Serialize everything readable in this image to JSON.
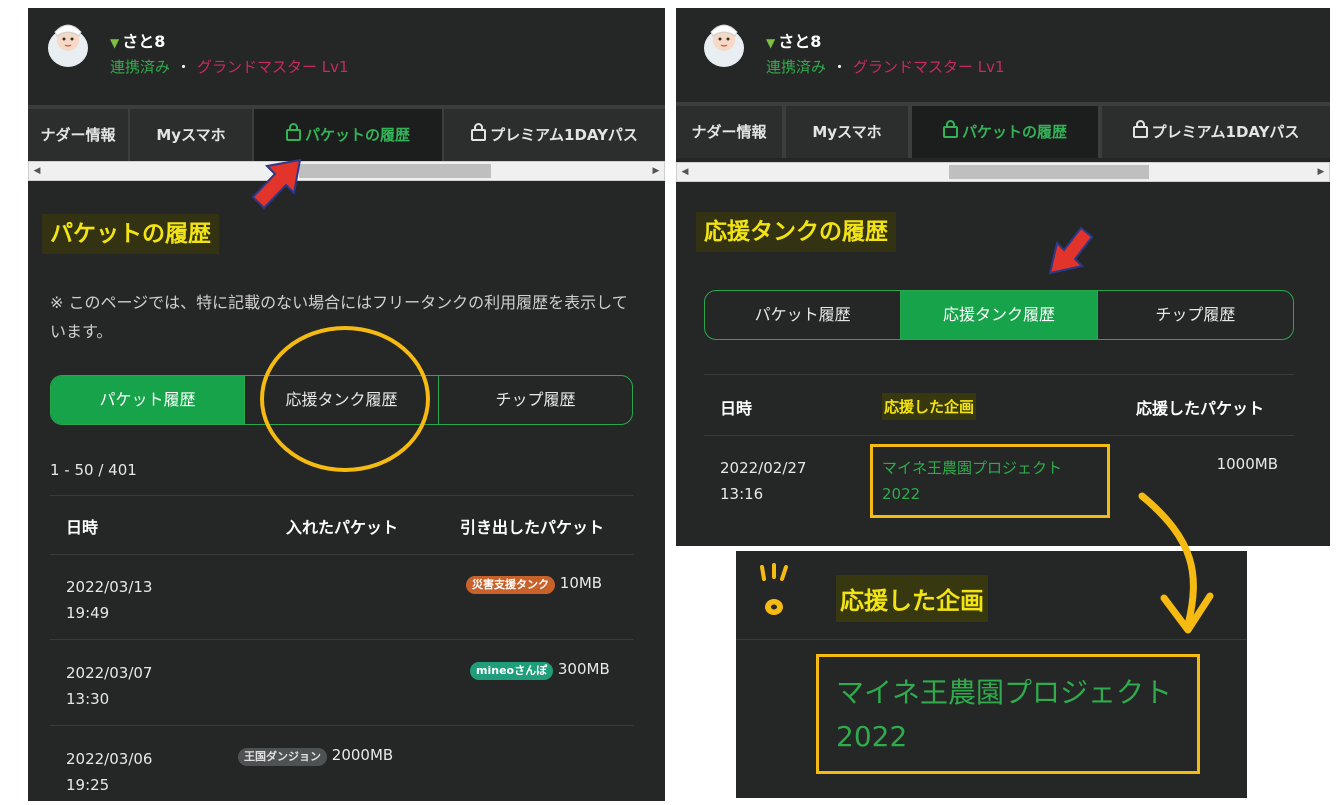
{
  "user": {
    "name": "さと8",
    "status_linked": "連携済み",
    "separator": "・",
    "rank": "グランドマスター Lv1"
  },
  "tabs": {
    "tab1": "ナダー情報",
    "tab2": "Myスマホ",
    "tab3": "パケットの履歴",
    "tab4": "プレミアム1DAYパス"
  },
  "left": {
    "section_title": "パケットの履歴",
    "note": "※ このページでは、特に記載のない場合にはフリータンクの利用履歴を表示しています。",
    "segment": [
      "パケット履歴",
      "応援タンク履歴",
      "チップ履歴"
    ],
    "count": "1 - 50 / 401",
    "columns": [
      "日時",
      "入れたパケット",
      "引き出したパケット"
    ],
    "rows": [
      {
        "date": "2022/03/13",
        "time": "19:49",
        "badge": "災害支援タンク",
        "amount": "10MB"
      },
      {
        "date": "2022/03/07",
        "time": "13:30",
        "badge": "mineoさんぽ",
        "amount": "300MB"
      },
      {
        "date": "2022/03/06",
        "time": "19:25",
        "badge": "王国ダンジョン",
        "amount": "2000MB"
      }
    ]
  },
  "right": {
    "section_title": "応援タンクの履歴",
    "segment": [
      "パケット履歴",
      "応援タンク履歴",
      "チップ履歴"
    ],
    "columns": [
      "日時",
      "応援した企画",
      "応援したパケット"
    ],
    "row": {
      "date": "2022/02/27",
      "time": "13:16",
      "project_line1": "マイネ王農園プロジェクト",
      "project_line2": "2022",
      "amount": "1000MB"
    }
  },
  "zoom": {
    "header": "応援した企画",
    "project_line1": "マイネ王農園プロジェクト",
    "project_line2": "2022"
  },
  "colors": {
    "panel_bg": "#252626",
    "accent_green": "#16a34a",
    "highlight_yellow": "#f2e313",
    "annotation_yellow": "#f6bb12",
    "annotation_red": "#e3342b",
    "rank_magenta": "#c72a62"
  }
}
